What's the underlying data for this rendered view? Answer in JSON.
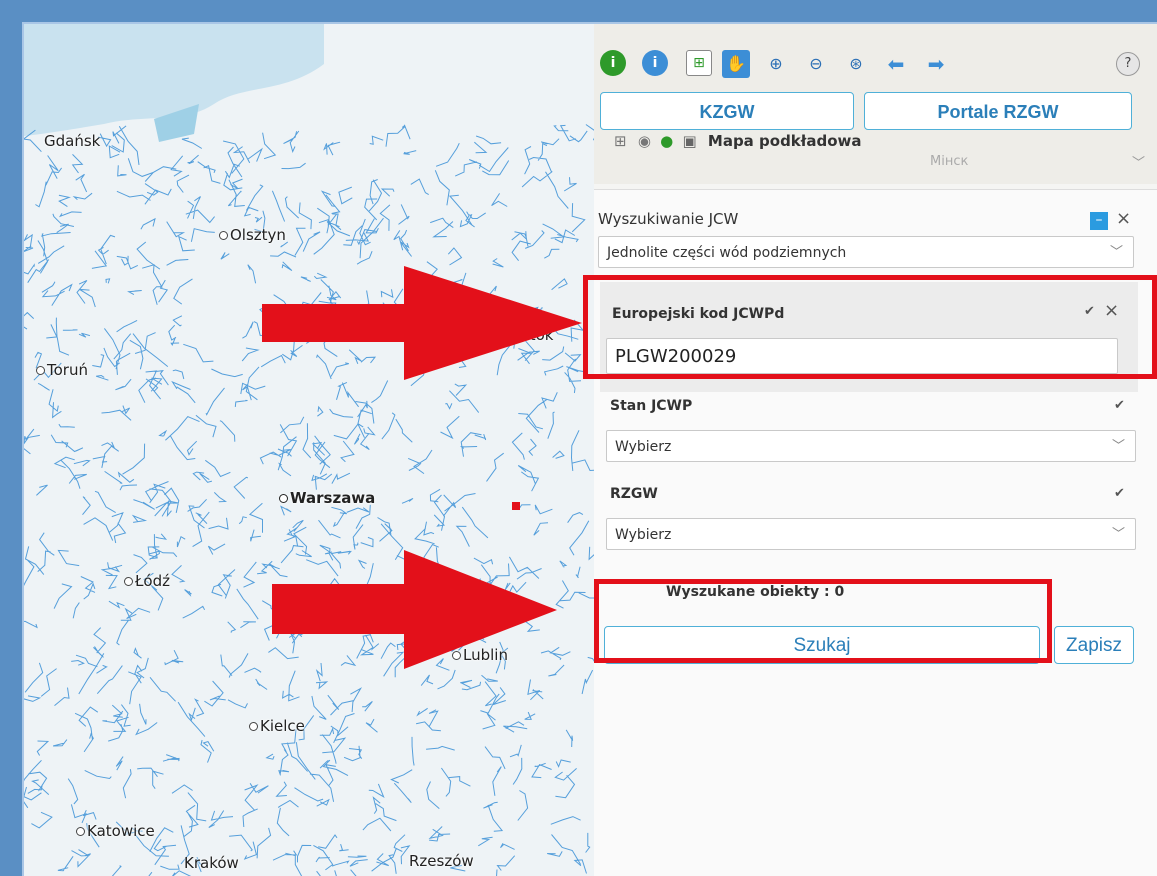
{
  "map": {
    "cities": [
      {
        "id": "gdansk",
        "name": "Gdańsk"
      },
      {
        "id": "olsztyn",
        "name": "Olsztyn"
      },
      {
        "id": "torun",
        "name": "Toruń"
      },
      {
        "id": "bialystok",
        "name": "ystok"
      },
      {
        "id": "warszawa",
        "name": "Warszawa"
      },
      {
        "id": "lodz",
        "name": "Łódź"
      },
      {
        "id": "lublin",
        "name": "Lublin"
      },
      {
        "id": "kielce",
        "name": "Kielce"
      },
      {
        "id": "katowice",
        "name": "Katowice"
      },
      {
        "id": "krakow",
        "name": "Kraków"
      },
      {
        "id": "rzeszow",
        "name": "Rzeszów"
      },
      {
        "id": "minsk",
        "name": "Мінск"
      }
    ]
  },
  "toolbar": {
    "links": {
      "kzgw": "KZGW",
      "portale": "Portale RZGW"
    },
    "layer_label": "Mapa podkładowa",
    "help": "?"
  },
  "search": {
    "title": "Wyszukiwanie JCW",
    "type_select": "Jednolite części wód podziemnych",
    "code_label": "Europejski kod JCWPd",
    "code_value": "PLGW200029",
    "stan_label": "Stan JCWP",
    "stan_select": "Wybierz",
    "rzgw_label": "RZGW",
    "rzgw_select": "Wybierz",
    "found_label": "Wyszukane obiekty : 0",
    "search_btn": "Szukaj",
    "save_btn": "Zapisz"
  },
  "colors": {
    "river": "#3a8fd6",
    "arrow": "#e3101a",
    "accent": "#2b7fb9",
    "frame": "#5a8fc4"
  }
}
